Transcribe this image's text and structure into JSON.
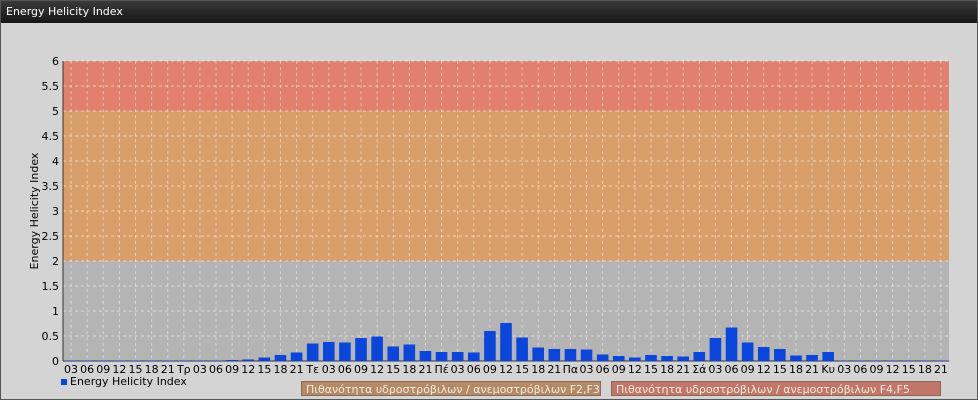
{
  "window": {
    "title": "Energy Helicity Index"
  },
  "legend": {
    "series_label": "Energy Helicity Index"
  },
  "notes": [
    {
      "label": "Πιθανότητα υδροστρόβιλων / ανεμοστρόβιλων F2,F3",
      "color": "#b48a66"
    },
    {
      "label": "Πιθανότητα υδροστρόβιλων / ανεμοστρόβιλων F4,F5",
      "color": "#c2766a"
    }
  ],
  "colors": {
    "bar": "#0a45dc",
    "band_low": "#b4b4b4",
    "band_mid": "#d99f6a",
    "band_high": "#e0806d"
  },
  "chart_data": {
    "type": "bar",
    "title": "",
    "xlabel": "",
    "ylabel": "Energy Helicity Index",
    "ylim": [
      0,
      6
    ],
    "yticks": [
      "0",
      "0.5",
      "1",
      "1.5",
      "2",
      "2.5",
      "3",
      "3.5",
      "4",
      "4.5",
      "5",
      "5.5",
      "6"
    ],
    "grid": true,
    "legend_position": "bottom-left",
    "bands": [
      {
        "from": 0,
        "to": 2,
        "color": "#b4b4b4"
      },
      {
        "from": 2,
        "to": 5,
        "color": "#d99f6a"
      },
      {
        "from": 5,
        "to": 6,
        "color": "#e0806d"
      }
    ],
    "categories": [
      "03",
      "06",
      "09",
      "12",
      "15",
      "18",
      "21",
      "Τρ",
      "03",
      "06",
      "09",
      "12",
      "15",
      "18",
      "21",
      "Τε",
      "03",
      "06",
      "09",
      "12",
      "15",
      "18",
      "21",
      "Πέ",
      "03",
      "06",
      "09",
      "12",
      "15",
      "18",
      "21",
      "Πα",
      "03",
      "06",
      "09",
      "12",
      "15",
      "18",
      "21",
      "Σά",
      "03",
      "06",
      "09",
      "12",
      "15",
      "18",
      "21",
      "Κυ",
      "03",
      "06",
      "09",
      "12",
      "15",
      "18",
      "21"
    ],
    "series": [
      {
        "name": "Energy Helicity Index",
        "values": [
          0.01,
          0.01,
          0.01,
          0.01,
          0.01,
          0.01,
          0.01,
          0.01,
          0.01,
          0.01,
          0.02,
          0.03,
          0.07,
          0.12,
          0.17,
          0.35,
          0.38,
          0.37,
          0.46,
          0.49,
          0.29,
          0.33,
          0.2,
          0.18,
          0.18,
          0.17,
          0.6,
          0.76,
          0.47,
          0.27,
          0.24,
          0.24,
          0.23,
          0.13,
          0.1,
          0.07,
          0.12,
          0.1,
          0.09,
          0.18,
          0.46,
          0.67,
          0.37,
          0.28,
          0.24,
          0.11,
          0.12,
          0.18,
          0.01,
          0.01,
          0.01,
          0.01,
          0.01,
          0.01,
          0.01
        ]
      }
    ]
  }
}
